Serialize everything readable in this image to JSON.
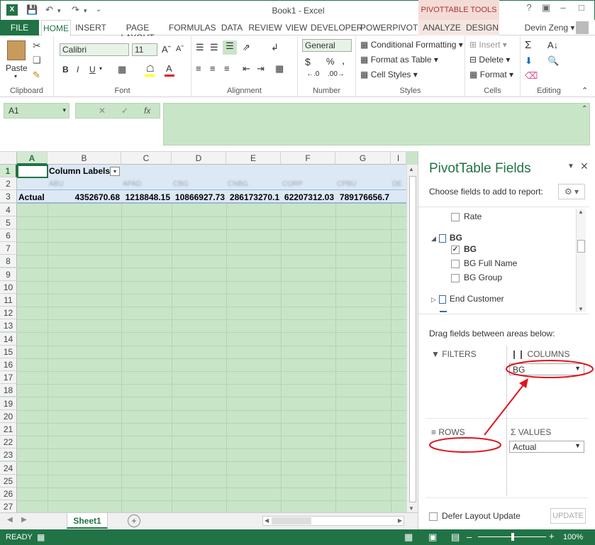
{
  "window": {
    "title": "Book1 - Excel",
    "context_tab_group": "PIVOTTABLE TOOLS",
    "user": "Devin Zeng"
  },
  "tabs": [
    "FILE",
    "HOME",
    "INSERT",
    "PAGE LAYOUT",
    "FORMULAS",
    "DATA",
    "REVIEW",
    "VIEW",
    "DEVELOPER",
    "POWERPIVOT",
    "ANALYZE",
    "DESIGN"
  ],
  "ribbon": {
    "clipboard": {
      "paste": "Paste",
      "label": "Clipboard"
    },
    "font": {
      "name": "Calibri",
      "size": "11",
      "label": "Font",
      "bold": "B",
      "italic": "I",
      "underline": "U"
    },
    "alignment": {
      "label": "Alignment"
    },
    "number": {
      "format": "General",
      "label": "Number",
      "currency": "$",
      "percent": "%",
      "comma": ","
    },
    "styles": {
      "conditional": "Conditional Formatting",
      "table": "Format as Table",
      "cell": "Cell Styles",
      "label": "Styles"
    },
    "cells": {
      "insert": "Insert",
      "delete": "Delete",
      "format": "Format",
      "label": "Cells"
    },
    "editing": {
      "label": "Editing"
    }
  },
  "formula_bar": {
    "name_box": "A1",
    "fx": "fx"
  },
  "grid": {
    "columns": [
      "A",
      "B",
      "C",
      "D",
      "E",
      "F",
      "G",
      "I"
    ],
    "rows": [
      "1",
      "2",
      "3",
      "4",
      "5",
      "6",
      "7",
      "8",
      "9",
      "10",
      "11",
      "12",
      "13",
      "14",
      "15",
      "16",
      "17",
      "18",
      "19",
      "20",
      "21",
      "22",
      "23",
      "24",
      "25",
      "26",
      "27"
    ],
    "pivot_header": "Column Labels",
    "blurred_headers": [
      "ABU",
      "APAD",
      "CBG",
      "CNBG",
      "CORP",
      "CPBU",
      "DE"
    ],
    "row3_label": "Actual",
    "row3_values": [
      "4352670.68",
      "1218848.15",
      "10866927.73",
      "286173270.1",
      "62207312.03",
      "789176656.7"
    ]
  },
  "sheet_tab": "Sheet1",
  "status": {
    "ready": "READY",
    "zoom": "100%"
  },
  "pivot_pane": {
    "title": "PivotTable Fields",
    "subtitle": "Choose fields to add to report:",
    "fields": [
      {
        "label": "Rate",
        "checked": false
      },
      {
        "label": "BG",
        "group": true
      },
      {
        "label": "BG",
        "checked": true,
        "bold": true
      },
      {
        "label": "BG Full Name",
        "checked": false
      },
      {
        "label": "BG Group",
        "checked": false
      },
      {
        "label": "End Customer",
        "group": true
      }
    ],
    "drag_hint": "Drag fields between areas below:",
    "filters_label": "FILTERS",
    "columns_label": "COLUMNS",
    "columns_value": "BG",
    "rows_label": "ROWS",
    "values_label": "VALUES",
    "values_value": "Actual",
    "defer_label": "Defer Layout Update",
    "update_button": "UPDATE"
  },
  "colors": {
    "excel_green": "#217346",
    "selection_green": "#c9e5c7",
    "annotation_red": "#e0141e"
  }
}
